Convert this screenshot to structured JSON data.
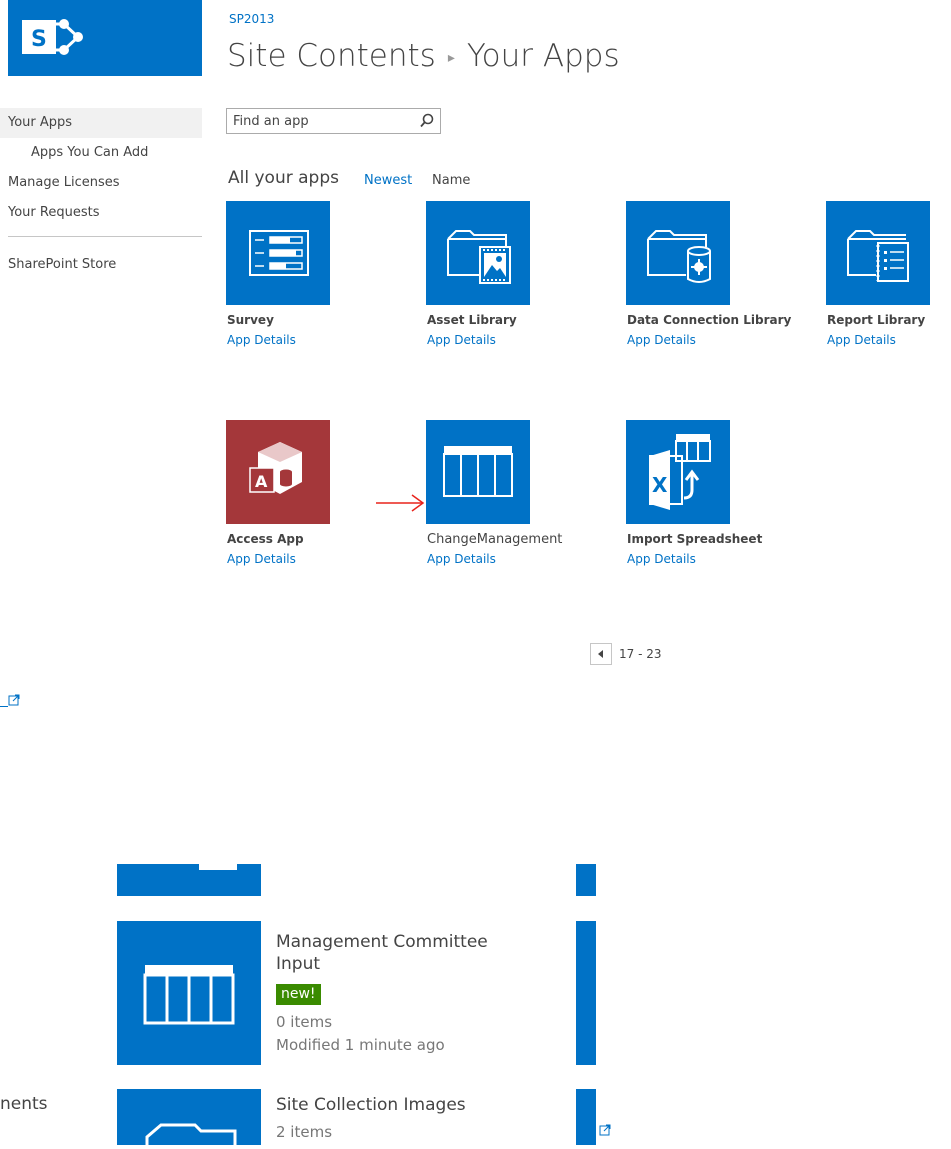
{
  "site": {
    "label": "SP2013"
  },
  "header": {
    "breadcrumb_parent": "Site Contents",
    "breadcrumb_current": "Your Apps"
  },
  "nav": {
    "items": [
      {
        "label": "Your Apps",
        "selected": true
      },
      {
        "label": "Apps You Can Add",
        "indent": true
      },
      {
        "label": "Manage Licenses"
      },
      {
        "label": "Your Requests"
      },
      {
        "label": "SharePoint Store"
      }
    ]
  },
  "search": {
    "placeholder": "Find an app"
  },
  "section": {
    "title": "All your apps",
    "sort_newest": "Newest",
    "sort_name": "Name"
  },
  "apps": [
    {
      "name": "Survey",
      "details": "App Details",
      "icon": "survey-icon"
    },
    {
      "name": "Asset Library",
      "details": "App Details",
      "icon": "asset-library-icon"
    },
    {
      "name": "Data Connection Library",
      "details": "App Details",
      "icon": "data-connection-library-icon"
    },
    {
      "name": "Report Library",
      "details": "App Details",
      "icon": "report-library-icon"
    },
    {
      "name": "Access App",
      "details": "App Details",
      "icon": "access-app-icon"
    },
    {
      "name": "ChangeManagement",
      "details": "App Details",
      "icon": "list-icon"
    },
    {
      "name": "Import Spreadsheet",
      "details": "App Details",
      "icon": "import-spreadsheet-icon"
    }
  ],
  "pager": {
    "range": "17 - 23"
  },
  "lower": {
    "items": [
      {
        "title_line1": "Management Committee",
        "title_line2": "Input",
        "badge": "new!",
        "count": "0 items",
        "modified": "Modified 1 minute ago"
      },
      {
        "title_line1": "Site Collection Images",
        "count": "2 items"
      }
    ],
    "left_fragment": "nents"
  },
  "colors": {
    "brand": "#0072c6",
    "access": "#a4373a",
    "new_badge": "#3a8b00",
    "arrow": "#e8231c"
  }
}
